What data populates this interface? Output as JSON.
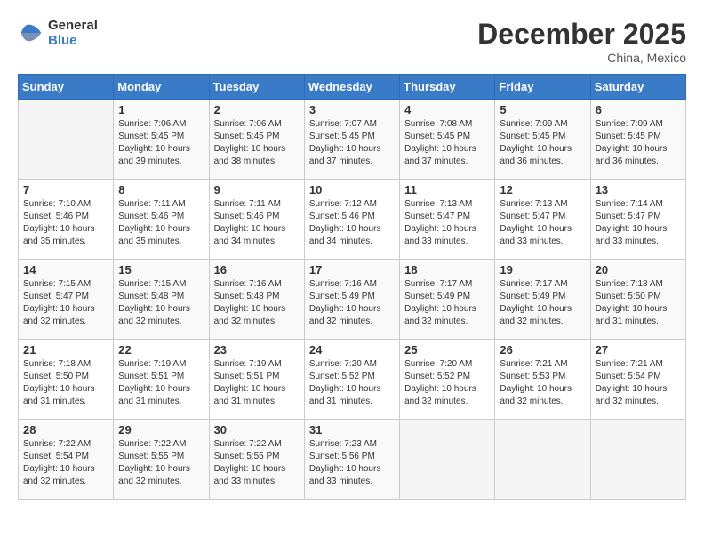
{
  "logo": {
    "general": "General",
    "blue": "Blue"
  },
  "header": {
    "month_year": "December 2025",
    "location": "China, Mexico"
  },
  "days_of_week": [
    "Sunday",
    "Monday",
    "Tuesday",
    "Wednesday",
    "Thursday",
    "Friday",
    "Saturday"
  ],
  "weeks": [
    [
      {
        "day": "",
        "sunrise": "",
        "sunset": "",
        "daylight": ""
      },
      {
        "day": "1",
        "sunrise": "Sunrise: 7:06 AM",
        "sunset": "Sunset: 5:45 PM",
        "daylight": "Daylight: 10 hours and 39 minutes."
      },
      {
        "day": "2",
        "sunrise": "Sunrise: 7:06 AM",
        "sunset": "Sunset: 5:45 PM",
        "daylight": "Daylight: 10 hours and 38 minutes."
      },
      {
        "day": "3",
        "sunrise": "Sunrise: 7:07 AM",
        "sunset": "Sunset: 5:45 PM",
        "daylight": "Daylight: 10 hours and 37 minutes."
      },
      {
        "day": "4",
        "sunrise": "Sunrise: 7:08 AM",
        "sunset": "Sunset: 5:45 PM",
        "daylight": "Daylight: 10 hours and 37 minutes."
      },
      {
        "day": "5",
        "sunrise": "Sunrise: 7:09 AM",
        "sunset": "Sunset: 5:45 PM",
        "daylight": "Daylight: 10 hours and 36 minutes."
      },
      {
        "day": "6",
        "sunrise": "Sunrise: 7:09 AM",
        "sunset": "Sunset: 5:45 PM",
        "daylight": "Daylight: 10 hours and 36 minutes."
      }
    ],
    [
      {
        "day": "7",
        "sunrise": "Sunrise: 7:10 AM",
        "sunset": "Sunset: 5:46 PM",
        "daylight": "Daylight: 10 hours and 35 minutes."
      },
      {
        "day": "8",
        "sunrise": "Sunrise: 7:11 AM",
        "sunset": "Sunset: 5:46 PM",
        "daylight": "Daylight: 10 hours and 35 minutes."
      },
      {
        "day": "9",
        "sunrise": "Sunrise: 7:11 AM",
        "sunset": "Sunset: 5:46 PM",
        "daylight": "Daylight: 10 hours and 34 minutes."
      },
      {
        "day": "10",
        "sunrise": "Sunrise: 7:12 AM",
        "sunset": "Sunset: 5:46 PM",
        "daylight": "Daylight: 10 hours and 34 minutes."
      },
      {
        "day": "11",
        "sunrise": "Sunrise: 7:13 AM",
        "sunset": "Sunset: 5:47 PM",
        "daylight": "Daylight: 10 hours and 33 minutes."
      },
      {
        "day": "12",
        "sunrise": "Sunrise: 7:13 AM",
        "sunset": "Sunset: 5:47 PM",
        "daylight": "Daylight: 10 hours and 33 minutes."
      },
      {
        "day": "13",
        "sunrise": "Sunrise: 7:14 AM",
        "sunset": "Sunset: 5:47 PM",
        "daylight": "Daylight: 10 hours and 33 minutes."
      }
    ],
    [
      {
        "day": "14",
        "sunrise": "Sunrise: 7:15 AM",
        "sunset": "Sunset: 5:47 PM",
        "daylight": "Daylight: 10 hours and 32 minutes."
      },
      {
        "day": "15",
        "sunrise": "Sunrise: 7:15 AM",
        "sunset": "Sunset: 5:48 PM",
        "daylight": "Daylight: 10 hours and 32 minutes."
      },
      {
        "day": "16",
        "sunrise": "Sunrise: 7:16 AM",
        "sunset": "Sunset: 5:48 PM",
        "daylight": "Daylight: 10 hours and 32 minutes."
      },
      {
        "day": "17",
        "sunrise": "Sunrise: 7:16 AM",
        "sunset": "Sunset: 5:49 PM",
        "daylight": "Daylight: 10 hours and 32 minutes."
      },
      {
        "day": "18",
        "sunrise": "Sunrise: 7:17 AM",
        "sunset": "Sunset: 5:49 PM",
        "daylight": "Daylight: 10 hours and 32 minutes."
      },
      {
        "day": "19",
        "sunrise": "Sunrise: 7:17 AM",
        "sunset": "Sunset: 5:49 PM",
        "daylight": "Daylight: 10 hours and 32 minutes."
      },
      {
        "day": "20",
        "sunrise": "Sunrise: 7:18 AM",
        "sunset": "Sunset: 5:50 PM",
        "daylight": "Daylight: 10 hours and 31 minutes."
      }
    ],
    [
      {
        "day": "21",
        "sunrise": "Sunrise: 7:18 AM",
        "sunset": "Sunset: 5:50 PM",
        "daylight": "Daylight: 10 hours and 31 minutes."
      },
      {
        "day": "22",
        "sunrise": "Sunrise: 7:19 AM",
        "sunset": "Sunset: 5:51 PM",
        "daylight": "Daylight: 10 hours and 31 minutes."
      },
      {
        "day": "23",
        "sunrise": "Sunrise: 7:19 AM",
        "sunset": "Sunset: 5:51 PM",
        "daylight": "Daylight: 10 hours and 31 minutes."
      },
      {
        "day": "24",
        "sunrise": "Sunrise: 7:20 AM",
        "sunset": "Sunset: 5:52 PM",
        "daylight": "Daylight: 10 hours and 31 minutes."
      },
      {
        "day": "25",
        "sunrise": "Sunrise: 7:20 AM",
        "sunset": "Sunset: 5:52 PM",
        "daylight": "Daylight: 10 hours and 32 minutes."
      },
      {
        "day": "26",
        "sunrise": "Sunrise: 7:21 AM",
        "sunset": "Sunset: 5:53 PM",
        "daylight": "Daylight: 10 hours and 32 minutes."
      },
      {
        "day": "27",
        "sunrise": "Sunrise: 7:21 AM",
        "sunset": "Sunset: 5:54 PM",
        "daylight": "Daylight: 10 hours and 32 minutes."
      }
    ],
    [
      {
        "day": "28",
        "sunrise": "Sunrise: 7:22 AM",
        "sunset": "Sunset: 5:54 PM",
        "daylight": "Daylight: 10 hours and 32 minutes."
      },
      {
        "day": "29",
        "sunrise": "Sunrise: 7:22 AM",
        "sunset": "Sunset: 5:55 PM",
        "daylight": "Daylight: 10 hours and 32 minutes."
      },
      {
        "day": "30",
        "sunrise": "Sunrise: 7:22 AM",
        "sunset": "Sunset: 5:55 PM",
        "daylight": "Daylight: 10 hours and 33 minutes."
      },
      {
        "day": "31",
        "sunrise": "Sunrise: 7:23 AM",
        "sunset": "Sunset: 5:56 PM",
        "daylight": "Daylight: 10 hours and 33 minutes."
      },
      {
        "day": "",
        "sunrise": "",
        "sunset": "",
        "daylight": ""
      },
      {
        "day": "",
        "sunrise": "",
        "sunset": "",
        "daylight": ""
      },
      {
        "day": "",
        "sunrise": "",
        "sunset": "",
        "daylight": ""
      }
    ]
  ]
}
